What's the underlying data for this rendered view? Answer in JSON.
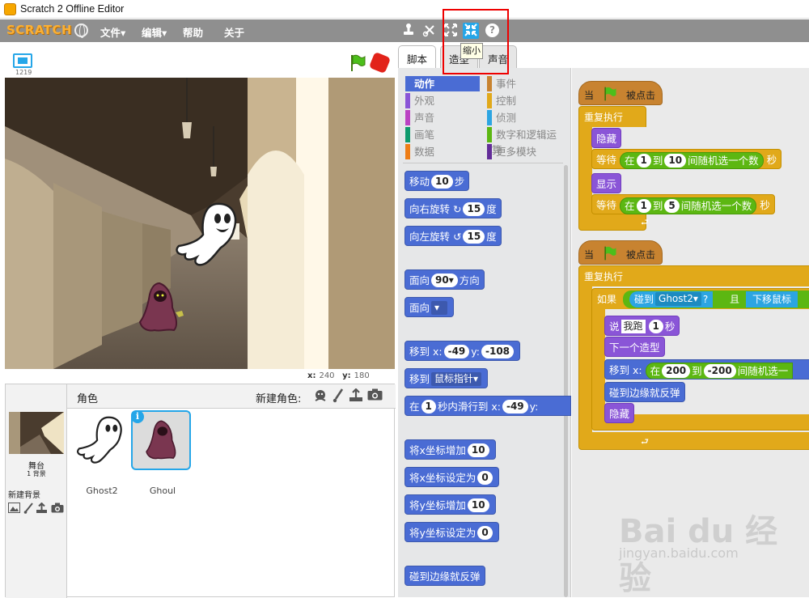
{
  "window": {
    "title": "Scratch 2 Offline Editor"
  },
  "menubar": {
    "logo": "SCRATCH",
    "menus": [
      "文件▾",
      "编辑▾",
      "帮助",
      "关于"
    ],
    "tooltip": "缩小"
  },
  "stage": {
    "version": "1219",
    "coords": {
      "x_label": "x:",
      "x": "240",
      "y_label": "y:",
      "y": "180"
    }
  },
  "sprites_panel": {
    "header": "角色",
    "new_sprite": "新建角色:",
    "stage_label": "舞台",
    "stage_bg_count": "1 背景",
    "new_backdrop": "新建背景",
    "sprites": [
      {
        "name": "Ghost2"
      },
      {
        "name": "Ghoul"
      }
    ]
  },
  "tabs": [
    "脚本",
    "造型",
    "声音"
  ],
  "palette": {
    "categories_left": [
      {
        "label": "动作",
        "color": "#4a6cd4"
      },
      {
        "label": "外观",
        "color": "#8a55d7"
      },
      {
        "label": "声音",
        "color": "#bb42c3"
      },
      {
        "label": "画笔",
        "color": "#0e9a6c"
      },
      {
        "label": "数据",
        "color": "#ee7d16"
      }
    ],
    "categories_right": [
      {
        "label": "事件",
        "color": "#c88330"
      },
      {
        "label": "控制",
        "color": "#e1a91a"
      },
      {
        "label": "侦测",
        "color": "#2ca5e2"
      },
      {
        "label": "数字和逻辑运算",
        "color": "#5cb712"
      },
      {
        "label": "更多模块",
        "color": "#632d99"
      }
    ],
    "blocks": {
      "move": {
        "a": "移动",
        "v": "10",
        "b": "步"
      },
      "turn_right": {
        "a": "向右旋转",
        "v": "15",
        "b": "度"
      },
      "turn_left": {
        "a": "向左旋转",
        "v": "15",
        "b": "度"
      },
      "point_dir": {
        "a": "面向",
        "v": "90▾",
        "b": "方向"
      },
      "point_towards": {
        "a": "面向"
      },
      "goto_xy": {
        "a": "移到 x:",
        "x": "-49",
        "b": "y:",
        "y": "-108"
      },
      "goto": {
        "a": "移到",
        "v": "鼠标指针▾"
      },
      "glide": {
        "a": "在",
        "v": "1",
        "b": "秒内滑行到 x:",
        "x": "-49",
        "c": "y:"
      },
      "change_x": {
        "a": "将x坐标增加",
        "v": "10"
      },
      "set_x": {
        "a": "将x坐标设定为",
        "v": "0"
      },
      "change_y": {
        "a": "将y坐标增加",
        "v": "10"
      },
      "set_y": {
        "a": "将y坐标设定为",
        "v": "0"
      },
      "bounce": {
        "a": "碰到边缘就反弹"
      }
    }
  },
  "scripts": {
    "s1": {
      "hat_a": "当",
      "hat_b": "被点击",
      "forever": "重复执行",
      "hide": "隐藏",
      "wait1": {
        "a": "等待",
        "b": "在",
        "v1": "1",
        "c": "到",
        "v2": "10",
        "d": "间随机选一个数",
        "e": "秒"
      },
      "show": "显示",
      "wait2": {
        "a": "等待",
        "b": "在",
        "v1": "1",
        "c": "到",
        "v2": "5",
        "d": "间随机选一个数",
        "e": "秒"
      }
    },
    "s2": {
      "hat_a": "当",
      "hat_b": "被点击",
      "forever": "重复执行",
      "if": "如果",
      "touching": "碰到",
      "sprite": "Ghost2▾",
      "q": "?",
      "and": "且",
      "mouse": "下移鼠标",
      "say": {
        "a": "说",
        "v1": "我跑",
        "v2": "1",
        "b": "秒"
      },
      "next_costume": "下一个造型",
      "goto": {
        "a": "移到 x:",
        "b": "在",
        "v1": "200",
        "c": "到",
        "v2": "-200",
        "d": "间随机选一"
      },
      "bounce": "碰到边缘就反弹",
      "hide": "隐藏"
    }
  },
  "watermark": {
    "brand": "Bai du 经验",
    "url": "jingyan.baidu.com"
  }
}
